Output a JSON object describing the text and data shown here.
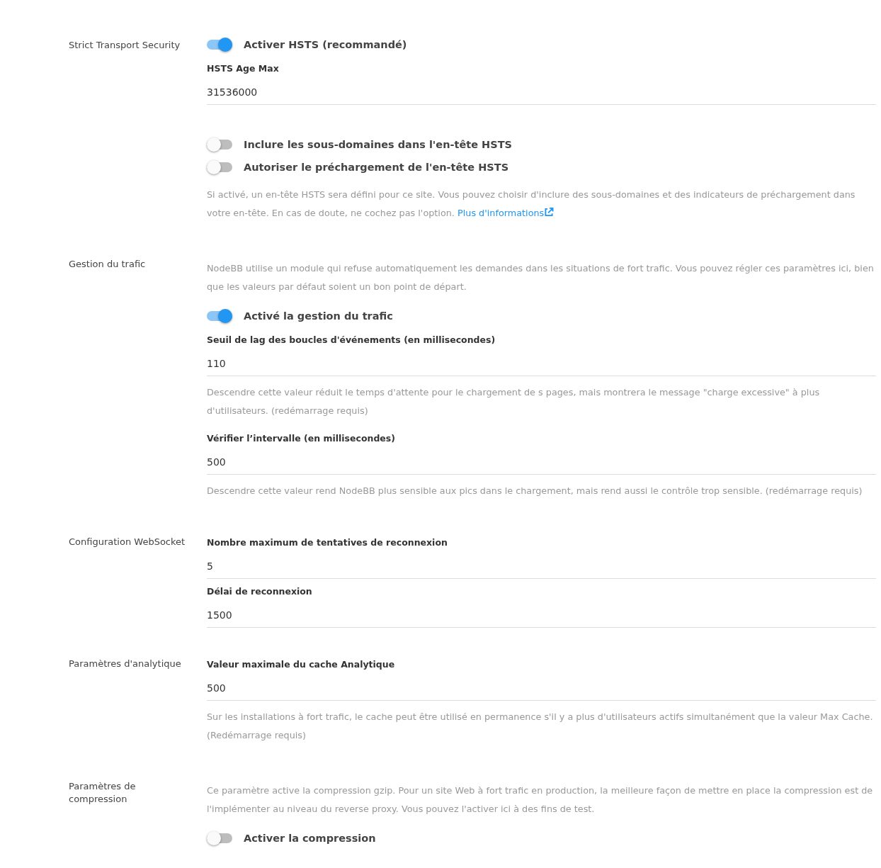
{
  "sections": [
    {
      "label": "Strict Transport Security",
      "items": [
        {
          "kind": "toggle",
          "label": "Activer HSTS (recommandé)",
          "on": true
        },
        {
          "kind": "field",
          "label": "HSTS Age Max",
          "value": "31536000"
        },
        {
          "kind": "toggle",
          "label": "Inclure les sous-domaines dans l'en-tête HSTS",
          "on": false
        },
        {
          "kind": "toggle",
          "label": "Autoriser le préchargement de l'en-tête HSTS",
          "on": false
        },
        {
          "kind": "help",
          "text": "Si activé, un en-tête HSTS sera défini pour ce site. Vous pouvez choisir d'inclure des sous-domaines et des indicateurs de préchargement dans votre en-tête. En cas de doute, ne cochez pas l'option.",
          "link": "Plus d'informations"
        }
      ]
    },
    {
      "label": "Gestion du trafic",
      "items": [
        {
          "kind": "help",
          "text": "NodeBB utilise un module qui refuse automatiquement les demandes dans les situations de fort trafic. Vous pouvez régler ces paramètres ici, bien que les valeurs par défaut soient un bon point de départ."
        },
        {
          "kind": "toggle",
          "label": "Activé la gestion du trafic",
          "on": true
        },
        {
          "kind": "field",
          "label": "Seuil de lag des boucles d'événements (en millisecondes)",
          "value": "110"
        },
        {
          "kind": "help",
          "text": "Descendre cette valeur réduit le temps d'attente pour le chargement de s pages, mais montrera le message \"charge excessive\" à plus d'utilisateurs. (redémarrage requis)"
        },
        {
          "kind": "field",
          "label": "Vérifier l’intervalle (en millisecondes)",
          "value": "500"
        },
        {
          "kind": "help",
          "text": "Descendre cette valeur rend NodeBB plus sensible aux pics dans le chargement, mais rend aussi le contrôle trop sensible. (redémarrage requis)"
        }
      ]
    },
    {
      "label": "Configuration WebSocket",
      "items": [
        {
          "kind": "field",
          "label": "Nombre maximum de tentatives de reconnexion",
          "value": "5"
        },
        {
          "kind": "field",
          "label": "Délai de reconnexion",
          "value": "1500"
        }
      ]
    },
    {
      "label": "Paramètres d'analytique",
      "items": [
        {
          "kind": "field",
          "label": "Valeur maximale du cache Analytique",
          "value": "500"
        },
        {
          "kind": "help",
          "text": "Sur les installations à fort trafic, le cache peut être utilisé en permanence s'il y a plus d'utilisateurs actifs simultanément que la valeur Max Cache. (Redémarrage requis)"
        }
      ]
    },
    {
      "label": "Paramètres de compression",
      "items": [
        {
          "kind": "help",
          "text": "Ce paramètre active la compression gzip. Pour un site Web à fort trafic en production, la meilleure façon de mettre en place la compression est de l'implémenter au niveau du reverse proxy. Vous pouvez l'activer ici à des fins de test."
        },
        {
          "kind": "toggle",
          "label": "Activer la compression",
          "on": false
        }
      ]
    }
  ]
}
